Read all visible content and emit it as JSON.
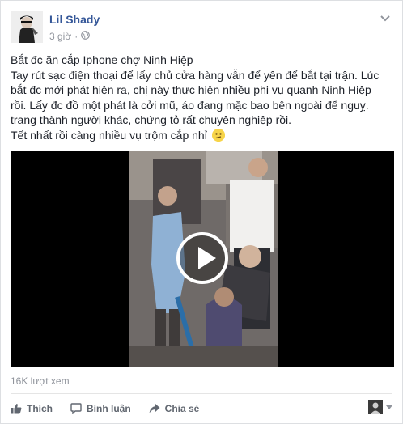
{
  "post": {
    "author": "Lil Shady",
    "time": "3 giờ",
    "privacy_icon": "globe-icon",
    "lines": [
      "Bắt đc ăn cắp Iphone chợ Ninh Hiệp",
      "Tay rút sạc điện thoại để lấy chủ cửa hàng vẫn để yên để bắt tại trận. Lúc",
      "bắt đc mới phát hiện ra, chị này thực hiện nhiều phi vụ quanh Ninh Hiệp",
      "rồi. Lấy đc đồ một phát là cởi mũ, áo đang mặc bao bên ngoài để nguỵ.",
      "trang thành người khác, chứng tỏ rất chuyên nghiệp rồi.",
      "Tết nhất rồi càng nhiều vụ trộm cắp nhỉ"
    ],
    "emoji": "confused-face-emoji",
    "views": "16K lượt xem"
  },
  "actions": {
    "like": "Thích",
    "comment": "Bình luận",
    "share": "Chia sẻ"
  },
  "colors": {
    "author_link": "#365899",
    "meta": "#90949c",
    "action_text": "#616770",
    "video_bg": "#000000"
  }
}
